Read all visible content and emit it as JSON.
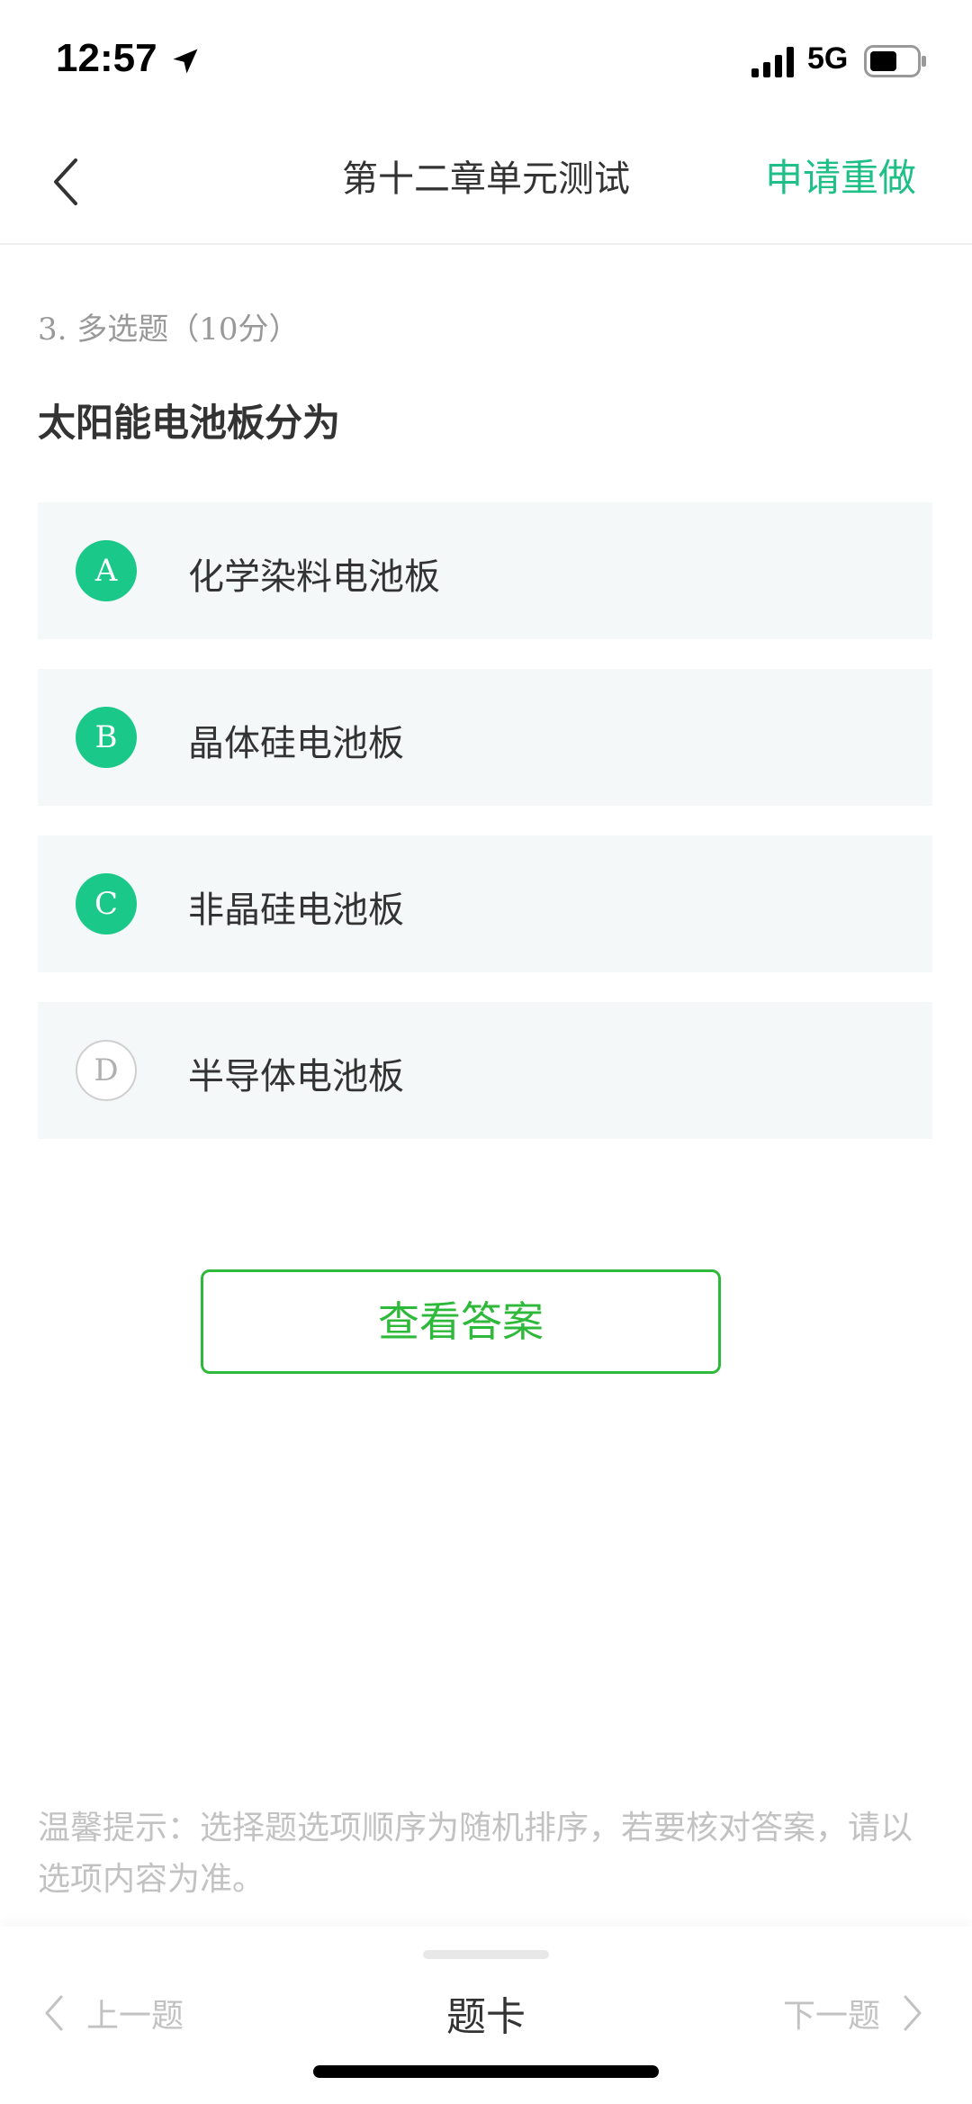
{
  "status_bar": {
    "time": "12:57",
    "network": "5G",
    "icons": [
      "location-arrow-icon",
      "signal-bars-icon",
      "battery-icon"
    ]
  },
  "nav": {
    "title": "第十二章单元测试",
    "redo_label": "申请重做",
    "back_icon": "chevron-left-icon"
  },
  "question": {
    "meta": "3. 多选题（10分）",
    "text": "太阳能电池板分为",
    "options": [
      {
        "letter": "A",
        "text": "化学染料电池板",
        "selected": true
      },
      {
        "letter": "B",
        "text": "晶体硅电池板",
        "selected": true
      },
      {
        "letter": "C",
        "text": "非晶硅电池板",
        "selected": true
      },
      {
        "letter": "D",
        "text": "半导体电池板",
        "selected": false
      }
    ]
  },
  "view_answer_label": "查看答案",
  "tip": "温馨提示：选择题选项顺序为随机排序，若要核对答案，请以选项内容为准。",
  "bottom_bar": {
    "prev_label": "上一题",
    "card_label": "题卡",
    "next_label": "下一题"
  },
  "colors": {
    "accent": "#1fbf87",
    "selected_badge": "#1ac98a",
    "answer_button": "#2fb93a",
    "option_bg": "#f4f8f8",
    "muted_text": "#c2c2c2"
  }
}
